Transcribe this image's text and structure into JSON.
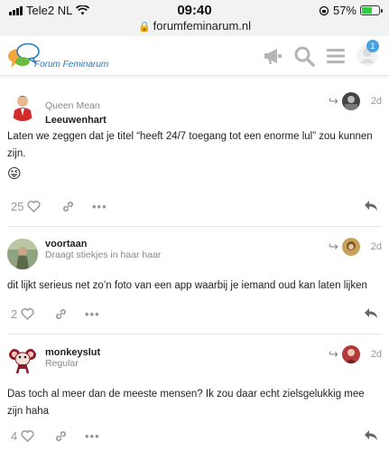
{
  "status_bar": {
    "carrier": "Tele2 NL",
    "time": "09:40",
    "battery": "57%",
    "url": "forumfeminarum.nl"
  },
  "header": {
    "logo_text": "Forum Feminarum",
    "notification_count": "1"
  },
  "posts": [
    {
      "username": "Leeuwenhart",
      "user_title": "Queen Mean",
      "date": "2d",
      "text": "Laten we zeggen dat je titel “heeft 24/7 toegang tot een enorme lul” zou kunnen zijn.",
      "emoji": "😜",
      "likes": "25"
    },
    {
      "username": "voortaan",
      "user_title": "Draagt stiekjes in haar haar",
      "date": "2d",
      "text": "dit lijkt serieus net zo’n foto van een app waarbij je iemand oud kan laten lijken",
      "likes": "2"
    },
    {
      "username": "monkeyslut",
      "user_title": "Regular",
      "date": "2d",
      "text": "Das toch al meer dan de meeste mensen? Ik zou daar echt zielsgelukkig mee zijn haha",
      "likes": "4"
    }
  ],
  "icons": {
    "announce": "megaphone-icon",
    "search": "search-icon",
    "menu": "hamburger-icon",
    "user": "user-avatar-icon",
    "like": "heart-icon",
    "link": "link-icon",
    "more": "more-icon",
    "reply": "reply-icon"
  },
  "colors": {
    "accent": "#4aa3df",
    "muted": "#999999",
    "logo_blue": "#2a7ab8"
  }
}
